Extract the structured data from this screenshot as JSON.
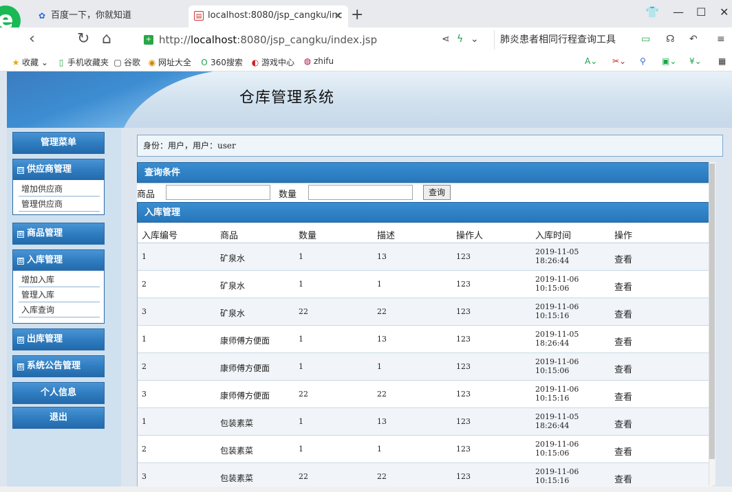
{
  "browser": {
    "tabs": [
      {
        "title": "百度一下，你就知道",
        "icon": "paw-icon"
      },
      {
        "title": "localhost:8080/jsp_cangku/inc",
        "icon": "page-icon"
      }
    ],
    "url_prefix": "http://",
    "url_host": "localhost",
    "url_rest": ":8080/jsp_cangku/index.jsp",
    "search_text": "肺炎患者相同行程查询工具",
    "bookmarks": [
      "收藏",
      "手机收藏夹",
      "谷歌",
      "网址大全",
      "360搜索",
      "游戏中心",
      "zhifu"
    ]
  },
  "header": {
    "title": "仓库管理系统"
  },
  "sidebar": {
    "menu_title": "管理菜单",
    "groups": [
      {
        "title": "供应商管理",
        "sign": "⊟",
        "items": [
          "增加供应商",
          "管理供应商"
        ]
      },
      {
        "title": "商品管理",
        "sign": "⊞",
        "items": []
      },
      {
        "title": "入库管理",
        "sign": "⊞",
        "items": [
          "增加入库",
          "管理入库",
          "入库查询"
        ]
      },
      {
        "title": "出库管理",
        "sign": "⊞",
        "items": []
      },
      {
        "title": "系统公告管理",
        "sign": "⊞",
        "items": []
      }
    ],
    "personal_info": "个人信息",
    "logout": "退出"
  },
  "identity": "身份：用户，用户：user",
  "query": {
    "title": "查询条件",
    "product_label": "商品",
    "quantity_label": "数量",
    "product_value": "",
    "quantity_value": "",
    "button": "查询"
  },
  "table": {
    "title": "入库管理",
    "columns": [
      "入库编号",
      "商品",
      "数量",
      "描述",
      "操作人",
      "入库时间",
      "操作"
    ],
    "rows": [
      {
        "id": "1",
        "product": "矿泉水",
        "qty": "1",
        "desc": "13",
        "operator": "123",
        "date": "2019-11-05",
        "time": "18:26:44",
        "action": "查看"
      },
      {
        "id": "2",
        "product": "矿泉水",
        "qty": "1",
        "desc": "1",
        "operator": "123",
        "date": "2019-11-06",
        "time": "10:15:06",
        "action": "查看"
      },
      {
        "id": "3",
        "product": "矿泉水",
        "qty": "22",
        "desc": "22",
        "operator": "123",
        "date": "2019-11-06",
        "time": "10:15:16",
        "action": "查看"
      },
      {
        "id": "1",
        "product": "康师傅方便面",
        "qty": "1",
        "desc": "13",
        "operator": "123",
        "date": "2019-11-05",
        "time": "18:26:44",
        "action": "查看"
      },
      {
        "id": "2",
        "product": "康师傅方便面",
        "qty": "1",
        "desc": "1",
        "operator": "123",
        "date": "2019-11-06",
        "time": "10:15:06",
        "action": "查看"
      },
      {
        "id": "3",
        "product": "康师傅方便面",
        "qty": "22",
        "desc": "22",
        "operator": "123",
        "date": "2019-11-06",
        "time": "10:15:16",
        "action": "查看"
      },
      {
        "id": "1",
        "product": "包装素菜",
        "qty": "1",
        "desc": "13",
        "operator": "123",
        "date": "2019-11-05",
        "time": "18:26:44",
        "action": "查看"
      },
      {
        "id": "2",
        "product": "包装素菜",
        "qty": "1",
        "desc": "1",
        "operator": "123",
        "date": "2019-11-06",
        "time": "10:15:06",
        "action": "查看"
      },
      {
        "id": "3",
        "product": "包装素菜",
        "qty": "22",
        "desc": "22",
        "operator": "123",
        "date": "2019-11-06",
        "time": "10:15:16",
        "action": "查看"
      }
    ]
  }
}
